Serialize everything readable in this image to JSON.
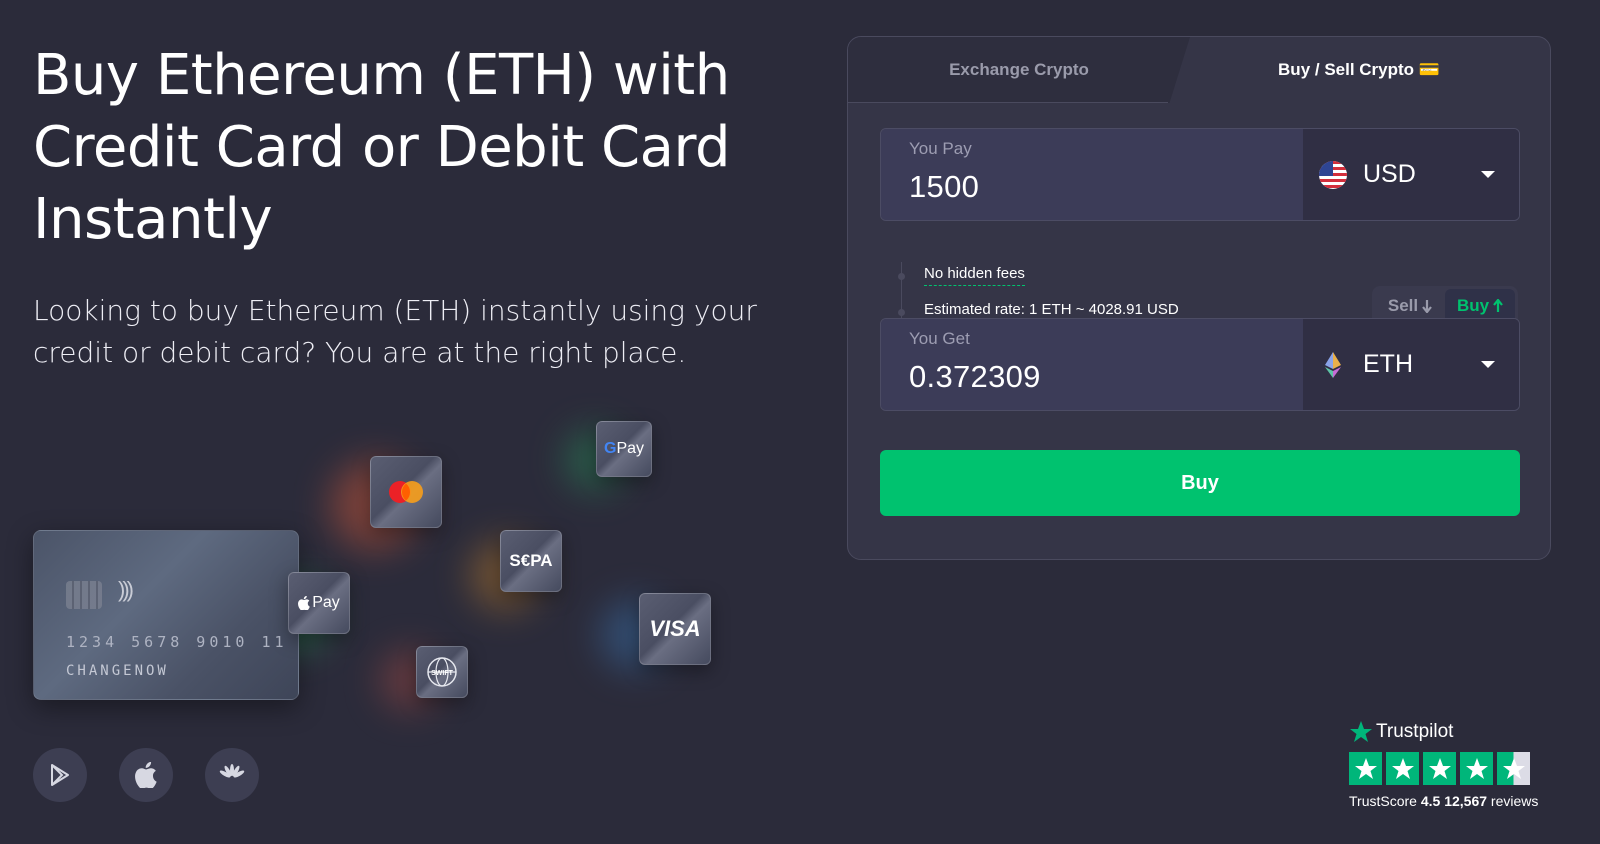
{
  "hero": {
    "title": "Buy Ethereum (ETH) with\nCredit Card or Debit Card\nInstantly",
    "subtitle": "Looking to buy Ethereum (ETH) instantly using your credit or debit card? You are at the right place."
  },
  "illustration": {
    "card_number": "1234  5678  9010  11",
    "card_name": "CHANGENOW",
    "methods": [
      {
        "name": "Mastercard",
        "icon": "mastercard-icon"
      },
      {
        "name": "Google Pay",
        "label_g": "G",
        "label_rest": "Pay",
        "icon": "google-pay-icon"
      },
      {
        "name": "SEPA",
        "label": "S€PA",
        "icon": "sepa-icon"
      },
      {
        "name": "Apple Pay",
        "label": "Pay",
        "icon": "apple-pay-icon"
      },
      {
        "name": "VISA",
        "label": "VISA",
        "icon": "visa-icon"
      },
      {
        "name": "SWIFT",
        "label": "SWIFT",
        "icon": "swift-icon"
      }
    ]
  },
  "stores": [
    {
      "name": "Google Play",
      "icon": "google-play-icon"
    },
    {
      "name": "App Store",
      "icon": "apple-icon"
    },
    {
      "name": "Huawei AppGallery",
      "icon": "huawei-icon"
    }
  ],
  "widget": {
    "tabs": [
      {
        "label": "Exchange Crypto",
        "active": false
      },
      {
        "label": "Buy / Sell Crypto 💳",
        "active": true
      }
    ],
    "pay": {
      "label": "You Pay",
      "value": "1500",
      "currency": "USD",
      "icon": "us-flag-icon"
    },
    "info": {
      "no_fees": "No hidden fees",
      "rate": "Estimated rate: 1 ETH ~ 4028.91 USD"
    },
    "switch": {
      "sell": "Sell",
      "buy": "Buy"
    },
    "get": {
      "label": "You Get",
      "value": "0.372309",
      "currency": "ETH",
      "icon": "ethereum-icon"
    },
    "button": "Buy"
  },
  "trustpilot": {
    "brand": "Trustpilot",
    "label": "TrustScore",
    "score": "4.5",
    "reviews_count": "12,567",
    "reviews_word": "reviews",
    "rating_stars": 4.5
  },
  "colors": {
    "background": "#2b2b3a",
    "accent": "#00c26f",
    "trustpilot": "#00b67a"
  }
}
